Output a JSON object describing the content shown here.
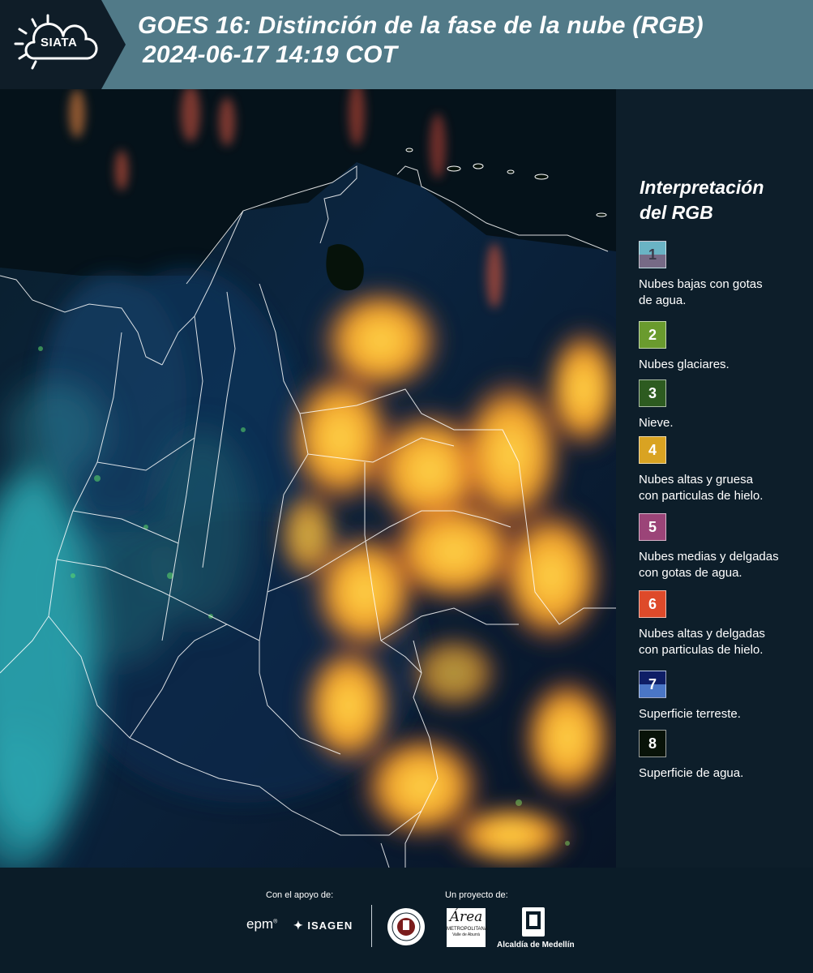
{
  "header": {
    "logo_text": "SIATA",
    "title_line1": "GOES 16: Distinción de la fase de la nube (RGB)",
    "title_line2": "2024-06-17 14:19 COT"
  },
  "legend": {
    "title_line1": "Interpretación",
    "title_line2": "del RGB",
    "items": [
      {
        "number": "1",
        "text_line1": "Nubes bajas con gotas",
        "text_line2": "de agua.",
        "color": "#6ab3c4",
        "color2": "#766a86"
      },
      {
        "number": "2",
        "text_line1": "Nubes glaciares.",
        "text_line2": "",
        "color": "#6a9b2e"
      },
      {
        "number": "3",
        "text_line1": "Nieve.",
        "text_line2": "",
        "color": "#2d5b20"
      },
      {
        "number": "4",
        "text_line1": "Nubes altas y gruesa",
        "text_line2": "con particulas de hielo.",
        "color": "#d9a322"
      },
      {
        "number": "5",
        "text_line1": "Nubes medias y delgadas",
        "text_line2": "con gotas de agua.",
        "color": "#9b4478"
      },
      {
        "number": "6",
        "text_line1": "Nubes altas y delgadas",
        "text_line2": "con particulas de hielo.",
        "color": "#de4a2a"
      },
      {
        "number": "7",
        "text_line1": "Superficie terreste.",
        "text_line2": "",
        "color": "#0e1e66",
        "color2": "#4a76c6"
      },
      {
        "number": "8",
        "text_line1": "Superficie de agua.",
        "text_line2": "",
        "color": "#081208"
      }
    ]
  },
  "footer": {
    "support_label": "Con el apoyo de:",
    "project_label": "Un proyecto de:",
    "sponsor_epm": "epm",
    "sponsor_isagen": "ISAGEN",
    "logo_metropolitana": "Área",
    "logo_metropolitana_sub": "METROPOLITANA",
    "logo_metropolitana_sub2": "Valle de Aburrá",
    "logo_alcaldia": "Alcaldía de Medellín"
  }
}
